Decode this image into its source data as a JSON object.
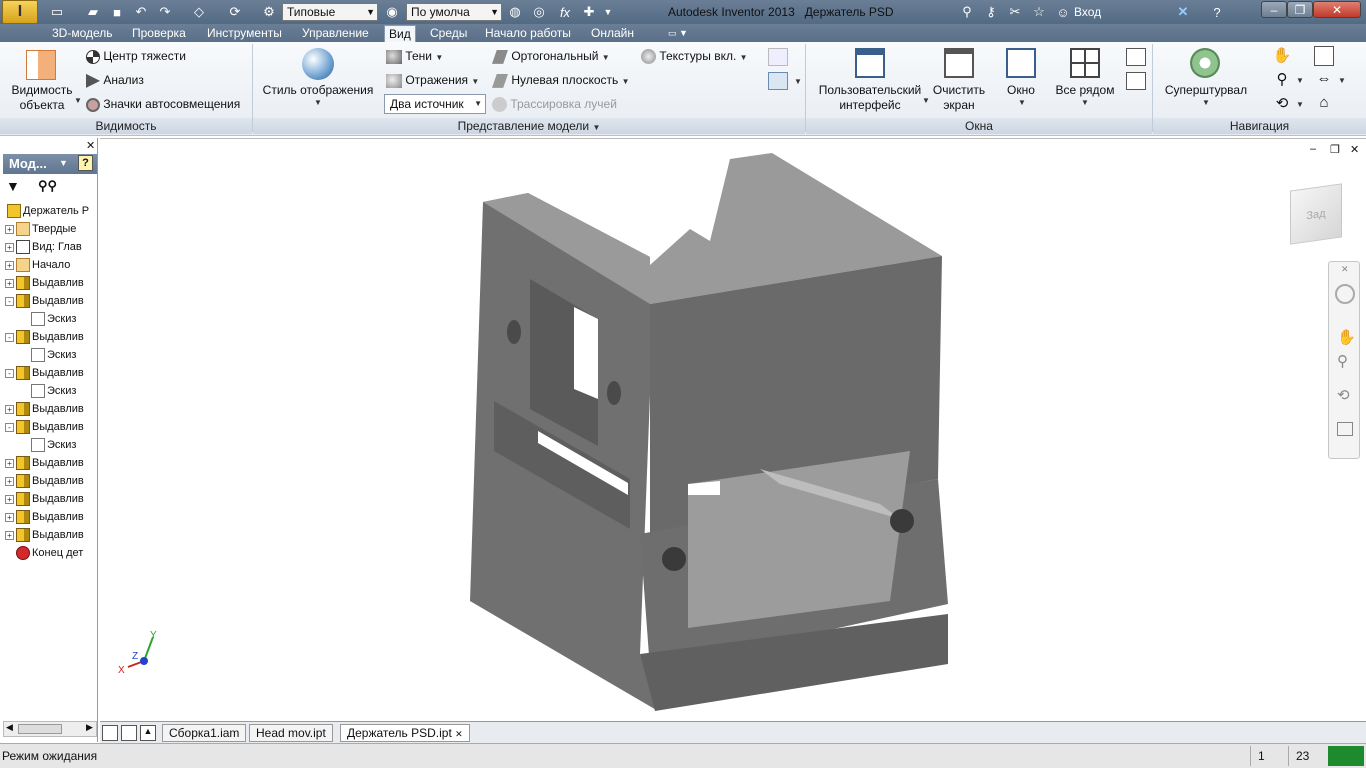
{
  "titlebar": {
    "app_title": "Autodesk Inventor 2013",
    "doc_title": "Держатель PSD",
    "style_combo": "Типовые",
    "material_combo": "По умолча",
    "login": "Вход"
  },
  "menu": {
    "tabs": [
      "3D-модель",
      "Проверка",
      "Инструменты",
      "Управление",
      "Вид",
      "Среды",
      "Начало работы",
      "Онлайн"
    ],
    "active": "Вид"
  },
  "ribbon": {
    "visibility": {
      "big_label1": "Видимость",
      "big_label2": "объекта",
      "items": [
        "Центр тяжести",
        "Анализ",
        "Значки автосовмещения"
      ],
      "footer": "Видимость"
    },
    "model_view": {
      "style_label": "Стиль отображения",
      "shadows": "Тени",
      "reflections": "Отражения",
      "lighting_combo": "Два источник",
      "orthographic": "Ортогональный",
      "ground_plane": "Нулевая плоскость",
      "ray_tracing": "Трассировка лучей",
      "textures": "Текстуры вкл.",
      "footer": "Представление модели"
    },
    "windows": {
      "user_interface1": "Пользовательский",
      "user_interface2": "интерфейс",
      "clean_screen1": "Очистить",
      "clean_screen2": "экран",
      "window": "Окно",
      "tile_all": "Все рядом",
      "footer": "Окна"
    },
    "navigation": {
      "steering_wheel": "Суперштурвал",
      "footer": "Навигация"
    }
  },
  "browser": {
    "header": "Мод...",
    "tree": [
      {
        "label": "Держатель P",
        "icon": "part-icon",
        "indent": 0,
        "pm": ""
      },
      {
        "label": "Твердые",
        "icon": "folder-icon",
        "indent": 1,
        "pm": "+"
      },
      {
        "label": "Вид: Глав",
        "icon": "view-icon",
        "indent": 1,
        "pm": "+"
      },
      {
        "label": "Начало",
        "icon": "folder-icon",
        "indent": 1,
        "pm": "+"
      },
      {
        "label": "Выдавлив",
        "icon": "extrude-icon",
        "indent": 1,
        "pm": "+"
      },
      {
        "label": "Выдавлив",
        "icon": "extrude-icon",
        "indent": 1,
        "pm": "-"
      },
      {
        "label": "Эскиз",
        "icon": "sketch-icon",
        "indent": 2,
        "pm": ""
      },
      {
        "label": "Выдавлив",
        "icon": "extrude-icon",
        "indent": 1,
        "pm": "-"
      },
      {
        "label": "Эскиз",
        "icon": "sketch-icon",
        "indent": 2,
        "pm": ""
      },
      {
        "label": "Выдавлив",
        "icon": "extrude-icon",
        "indent": 1,
        "pm": "-"
      },
      {
        "label": "Эскиз",
        "icon": "sketch-icon",
        "indent": 2,
        "pm": ""
      },
      {
        "label": "Выдавлив",
        "icon": "extrude-icon",
        "indent": 1,
        "pm": "+"
      },
      {
        "label": "Выдавлив",
        "icon": "extrude-icon",
        "indent": 1,
        "pm": "-"
      },
      {
        "label": "Эскиз",
        "icon": "sketch-icon",
        "indent": 2,
        "pm": ""
      },
      {
        "label": "Выдавлив",
        "icon": "extrude-icon",
        "indent": 1,
        "pm": "+"
      },
      {
        "label": "Выдавлив",
        "icon": "extrude-icon",
        "indent": 1,
        "pm": "+"
      },
      {
        "label": "Выдавлив",
        "icon": "extrude-icon",
        "indent": 1,
        "pm": "+"
      },
      {
        "label": "Выдавлив",
        "icon": "extrude-icon",
        "indent": 1,
        "pm": "+"
      },
      {
        "label": "Выдавлив",
        "icon": "extrude-icon",
        "indent": 1,
        "pm": "+"
      },
      {
        "label": "Конец дет",
        "icon": "end-icon",
        "indent": 1,
        "pm": ""
      }
    ]
  },
  "viewcube": {
    "face": "Зад"
  },
  "axes": {
    "x": "X",
    "y": "Y",
    "z": "Z"
  },
  "doctabs": [
    "Сборка1.iam",
    "Head mov.ipt",
    "Держатель PSD.ipt"
  ],
  "active_doc": "Держатель PSD.ipt",
  "status": {
    "text": "Режим ожидания",
    "num1": "1",
    "num2": "23"
  },
  "colors": {
    "titlebar": "#5e748d",
    "model": "#7b7b7b",
    "accent": "#1e8a2e"
  }
}
